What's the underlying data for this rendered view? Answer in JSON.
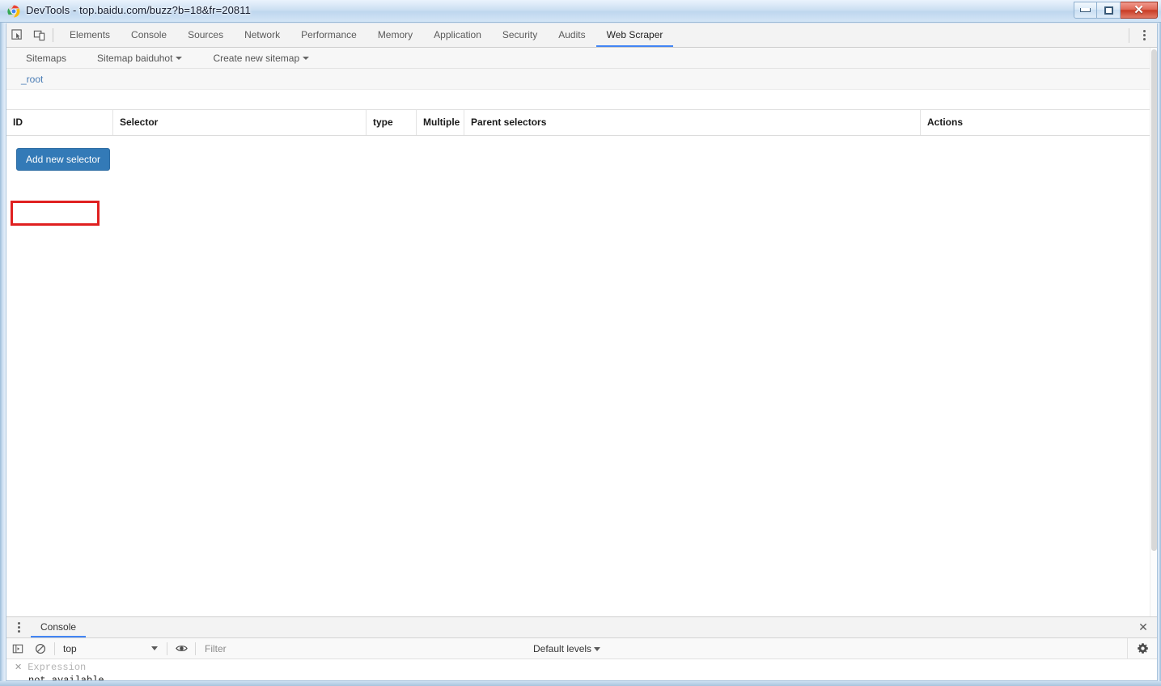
{
  "window": {
    "title": "DevTools - top.baidu.com/buzz?b=18&fr=20811",
    "app_icon": "chrome-icon",
    "controls": {
      "minimize": "minimize-icon",
      "maximize": "maximize-icon",
      "close": "✕"
    }
  },
  "devtools": {
    "left_tools": [
      {
        "name": "inspect-element-icon",
        "title": "Inspect element"
      },
      {
        "name": "device-toolbar-icon",
        "title": "Toggle device toolbar"
      }
    ],
    "tabs": [
      {
        "label": "Elements",
        "active": false
      },
      {
        "label": "Console",
        "active": false
      },
      {
        "label": "Sources",
        "active": false
      },
      {
        "label": "Network",
        "active": false
      },
      {
        "label": "Performance",
        "active": false
      },
      {
        "label": "Memory",
        "active": false
      },
      {
        "label": "Application",
        "active": false
      },
      {
        "label": "Security",
        "active": false
      },
      {
        "label": "Audits",
        "active": false
      },
      {
        "label": "Web Scraper",
        "active": true
      }
    ],
    "more_menu": "more-vertical-icon",
    "accent_color": "#4285f4"
  },
  "web_scraper": {
    "nav": [
      {
        "label": "Sitemaps",
        "has_caret": false
      },
      {
        "label": "Sitemap baiduhot",
        "has_caret": true
      },
      {
        "label": "Create new sitemap",
        "has_caret": true
      }
    ],
    "breadcrumb": "_root",
    "table": {
      "columns": [
        "ID",
        "Selector",
        "type",
        "Multiple",
        "Parent selectors",
        "Actions"
      ],
      "rows": []
    },
    "add_button": {
      "label": "Add new selector",
      "color": "#337ab7"
    },
    "annotation": {
      "target": "Add new selector",
      "color": "#e02020"
    }
  },
  "console_drawer": {
    "menu_icon": "more-vertical-icon",
    "tabs": [
      {
        "label": "Console",
        "active": true
      }
    ],
    "close_icon": "✕",
    "toolbar": {
      "sidebar_toggle_icon": "console-sidebar-icon",
      "clear_icon": "clear-console-icon",
      "context": "top",
      "eye_icon": "live-expression-eye-icon",
      "filter_placeholder": "Filter",
      "levels": "Default levels",
      "settings_icon": "gear-icon"
    },
    "messages": [
      {
        "dismiss": "✕",
        "expression": "Expression",
        "result": "not available"
      }
    ]
  }
}
